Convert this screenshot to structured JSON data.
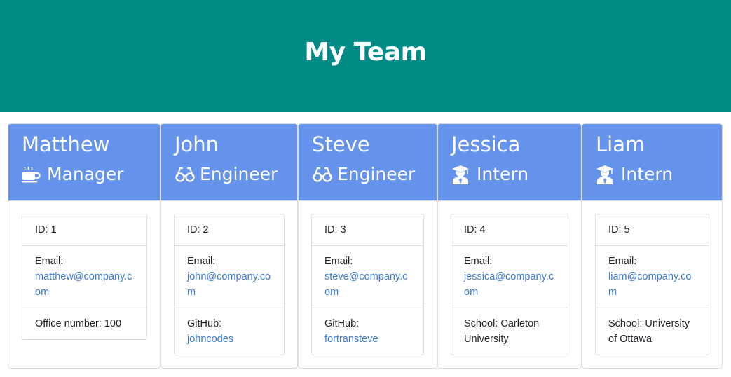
{
  "header": {
    "title": "My Team"
  },
  "colors": {
    "header_bg": "#008b87",
    "card_header_bg": "#6592ea",
    "link": "#3a7bd5"
  },
  "employees": [
    {
      "name": "Matthew",
      "role": "Manager",
      "icon": "mug-icon",
      "id_text": "ID: 1",
      "email_label": "Email:",
      "email": "matthew@company.com",
      "extra": "Office number: 100"
    },
    {
      "name": "John",
      "role": "Engineer",
      "icon": "glasses-icon",
      "id_text": "ID: 2",
      "email_label": "Email:",
      "email": "john@company.com",
      "extra_label": "GitHub:",
      "extra_link": "johncodes"
    },
    {
      "name": "Steve",
      "role": "Engineer",
      "icon": "glasses-icon",
      "id_text": "ID: 3",
      "email_label": "Email:",
      "email": "steve@company.com",
      "extra_label": "GitHub:",
      "extra_link": "fortransteve"
    },
    {
      "name": "Jessica",
      "role": "Intern",
      "icon": "graduate-icon",
      "id_text": "ID: 4",
      "email_label": "Email:",
      "email": "jessica@company.com",
      "extra": "School: Carleton University"
    },
    {
      "name": "Liam",
      "role": "Intern",
      "icon": "graduate-icon",
      "id_text": "ID: 5",
      "email_label": "Email:",
      "email": "liam@company.com",
      "extra": "School: University of Ottawa"
    }
  ]
}
